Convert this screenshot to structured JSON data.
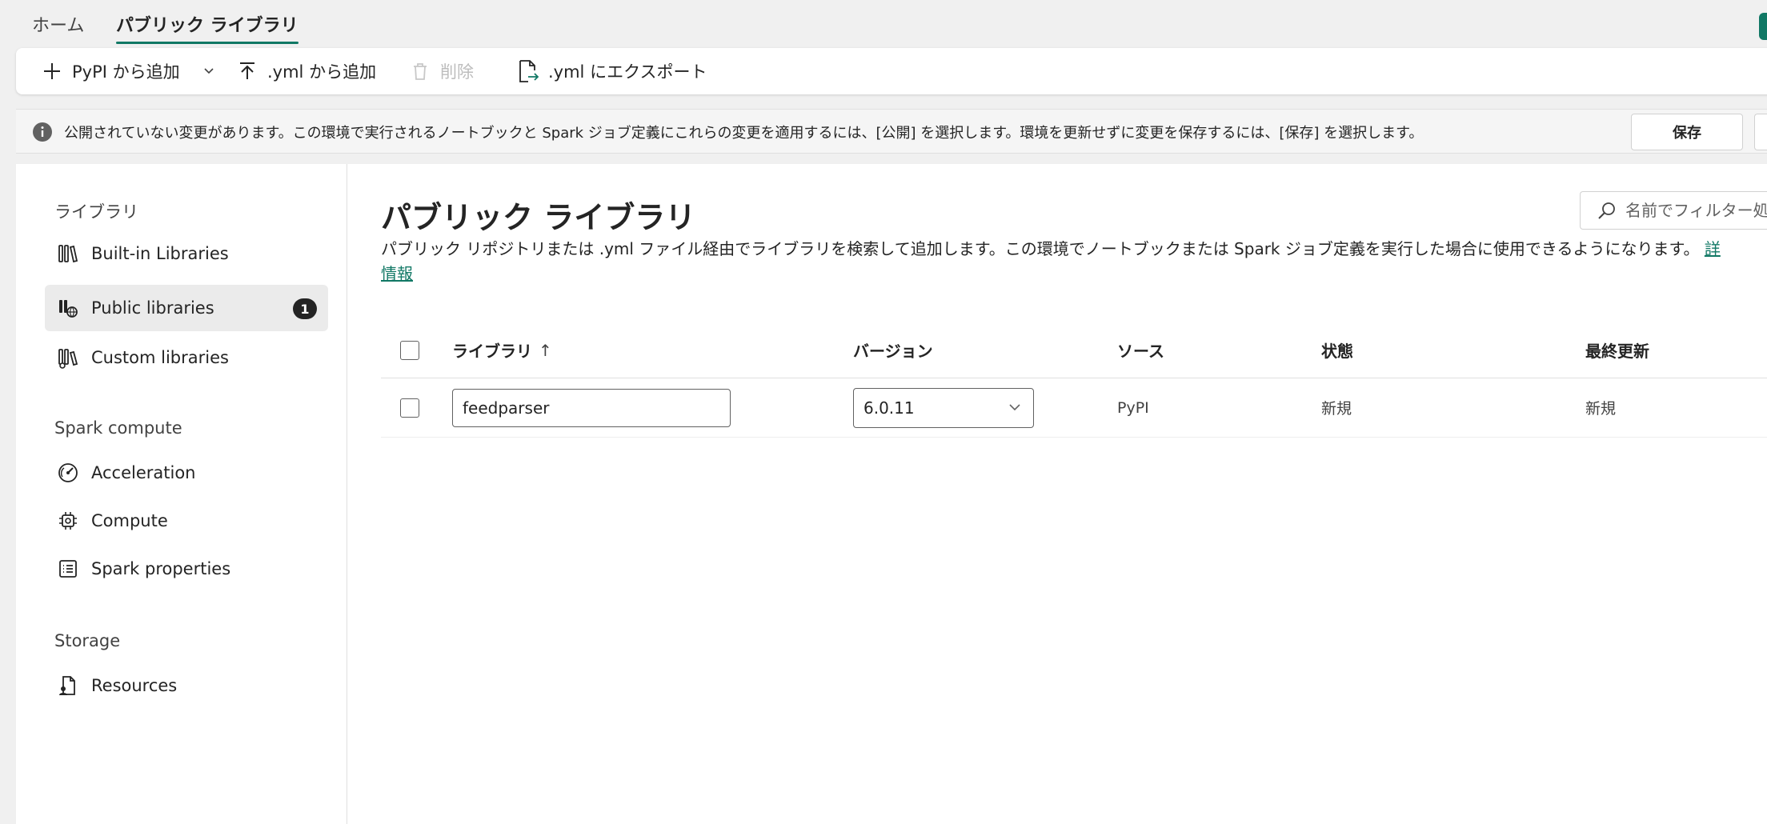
{
  "topnav": {
    "tabs": [
      {
        "label": "ホーム",
        "active": false
      },
      {
        "label": "パブリック ライブラリ",
        "active": true
      }
    ]
  },
  "toolbar": {
    "add_pypi": "PyPI から追加",
    "add_yml": ".yml から追加",
    "delete": "削除",
    "export_yml": ".yml にエクスポート"
  },
  "message_bar": {
    "text": "公開されていない変更があります。この環境で実行されるノートブックと Spark ジョブ定義にこれらの変更を適用するには、[公開] を選択します。環境を更新せずに変更を保存するには、[保存] を選択します。",
    "save_label": "保存"
  },
  "sidebar": {
    "sections": [
      {
        "label": "ライブラリ"
      },
      {
        "label": "Spark compute"
      },
      {
        "label": "Storage"
      }
    ],
    "items": [
      {
        "label": "Built-in Libraries",
        "icon": "books-icon"
      },
      {
        "label": "Public libraries",
        "icon": "public-books-icon",
        "badge": "1",
        "selected": true
      },
      {
        "label": "Custom libraries",
        "icon": "custom-books-icon"
      },
      {
        "label": "Acceleration",
        "icon": "gauge-icon"
      },
      {
        "label": "Compute",
        "icon": "chip-icon"
      },
      {
        "label": "Spark properties",
        "icon": "list-icon"
      },
      {
        "label": "Resources",
        "icon": "document-person-icon"
      }
    ]
  },
  "main": {
    "title": "パブリック ライブラリ",
    "description": "パブリック リポジトリまたは .yml ファイル経由でライブラリを検索して追加します。この環境でノートブックまたは Spark ジョブ定義を実行した場合に使用できるようになります。",
    "desc_link_start": "詳",
    "desc_link_end": "情報",
    "filter_placeholder": "名前でフィルター処理"
  },
  "table": {
    "headers": {
      "library": "ライブラリ",
      "sort_indicator": "↑",
      "version": "バージョン",
      "source": "ソース",
      "state": "状態",
      "last_updated": "最終更新"
    },
    "rows": [
      {
        "library": "feedparser",
        "version": "6.0.11",
        "source": "PyPI",
        "state": "新規",
        "last_updated": "新規"
      }
    ]
  },
  "colors": {
    "accent": "#117865",
    "badge": "#242424",
    "selected_bg": "#ebebeb"
  }
}
